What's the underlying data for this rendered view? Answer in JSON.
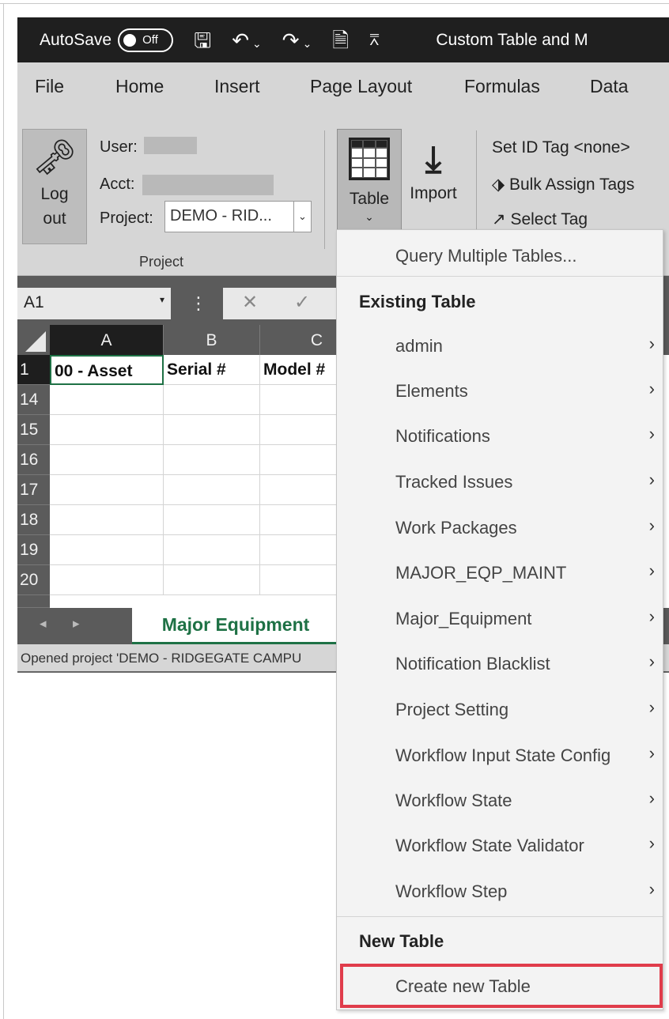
{
  "titlebar": {
    "autosave_label": "AutoSave",
    "autosave_state": "Off",
    "doc_title": "Custom Table and M"
  },
  "ribbon_tabs": [
    "File",
    "Home",
    "Insert",
    "Page Layout",
    "Formulas",
    "Data"
  ],
  "project_group": {
    "logout_line1": "Log",
    "logout_line2": "out",
    "user_label": "User:",
    "acct_label": "Acct:",
    "project_label": "Project:",
    "project_value": "DEMO - RID...",
    "group_label": "Project"
  },
  "table_group": {
    "table_label": "Table",
    "import_label": "Import",
    "set_id_tag": "Set ID Tag  <none>",
    "bulk_assign": "Bulk Assign Tags",
    "select_tag": "Select Tag"
  },
  "formula_bar": {
    "name_box": "A1"
  },
  "sheet": {
    "columns": [
      "A",
      "B",
      "C"
    ],
    "header_row_number": "1",
    "header_cells": [
      "00 - Asset",
      "Serial #",
      "Model #"
    ],
    "row_numbers": [
      "14",
      "15",
      "16",
      "17",
      "18",
      "19",
      "20"
    ],
    "active_tab": "Major Equipment"
  },
  "status_bar": {
    "text": "Opened project 'DEMO - RIDGEGATE CAMPU"
  },
  "menu": {
    "query_multiple": "Query Multiple Tables...",
    "existing_header": "Existing Table",
    "existing_tables": [
      "admin",
      "Elements",
      "Notifications",
      "Tracked Issues",
      "Work Packages",
      "MAJOR_EQP_MAINT",
      "Major_Equipment",
      "Notification Blacklist",
      "Project Setting",
      "Workflow Input State Config",
      "Workflow State",
      "Workflow State Validator",
      "Workflow Step"
    ],
    "new_header": "New Table",
    "create_new": "Create new Table"
  },
  "colors": {
    "accent_green": "#1e7145",
    "highlight_red": "#e03c4b",
    "titlebar_bg": "#1f1f1f",
    "ribbon_bg": "#d6d6d6"
  }
}
